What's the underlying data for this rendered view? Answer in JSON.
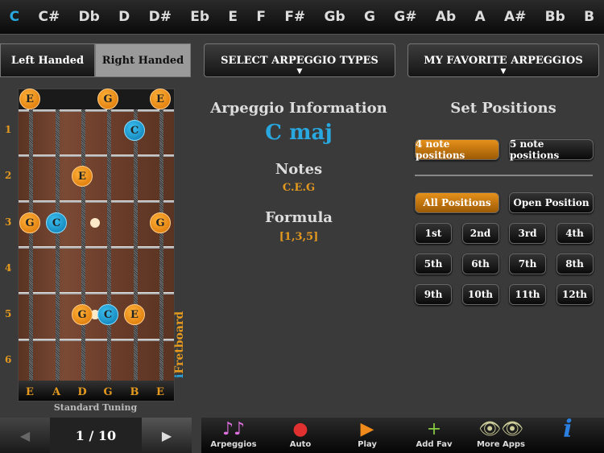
{
  "keys": [
    "C",
    "C#",
    "Db",
    "D",
    "D#",
    "Eb",
    "E",
    "F",
    "F#",
    "Gb",
    "G",
    "G#",
    "Ab",
    "A",
    "A#",
    "Bb",
    "B"
  ],
  "selected_key": "C",
  "hand": {
    "left": "Left Handed",
    "right": "Right Handed",
    "selected": "right"
  },
  "menus": {
    "types": "SELECT ARPEGGIO TYPES",
    "favorites": "MY FAVORITE ARPEGGIOS"
  },
  "info": {
    "title": "Arpeggio Information",
    "name": "C maj",
    "notes_label": "Notes",
    "notes": "C.E.G",
    "formula_label": "Formula",
    "formula": "[1,3,5]"
  },
  "positions": {
    "title": "Set Positions",
    "note_counts": [
      "4 note positions",
      "5 note positions"
    ],
    "selected_count": 0,
    "ranges": [
      "All Positions",
      "Open Position"
    ],
    "selected_range": 0,
    "frets": [
      "1st",
      "2nd",
      "3rd",
      "4th",
      "5th",
      "6th",
      "7th",
      "8th",
      "9th",
      "10th",
      "11th",
      "12th"
    ]
  },
  "fretboard": {
    "fret_numbers": [
      "1",
      "2",
      "3",
      "4",
      "5",
      "6"
    ],
    "strings": [
      "E",
      "A",
      "D",
      "G",
      "B",
      "E"
    ],
    "tuning": "Standard Tuning",
    "brand": "iFretboard",
    "notes": [
      {
        "s": 0,
        "f": 0,
        "n": "E",
        "c": "o"
      },
      {
        "s": 3,
        "f": 0,
        "n": "G",
        "c": "o"
      },
      {
        "s": 5,
        "f": 0,
        "n": "E",
        "c": "o"
      },
      {
        "s": 4,
        "f": 1,
        "n": "C",
        "c": "b"
      },
      {
        "s": 2,
        "f": 2,
        "n": "E",
        "c": "o"
      },
      {
        "s": 0,
        "f": 3,
        "n": "G",
        "c": "o"
      },
      {
        "s": 1,
        "f": 3,
        "n": "C",
        "c": "b"
      },
      {
        "s": 5,
        "f": 3,
        "n": "G",
        "c": "o"
      },
      {
        "s": 2,
        "f": 5,
        "n": "G",
        "c": "o"
      },
      {
        "s": 3,
        "f": 5,
        "n": "C",
        "c": "b"
      },
      {
        "s": 4,
        "f": 5,
        "n": "E",
        "c": "o"
      }
    ]
  },
  "pager": {
    "text": "1 / 10",
    "prev": "◀",
    "next": "▶"
  },
  "toolbar": [
    {
      "label": "Arpeggios",
      "icon": "♪♪"
    },
    {
      "label": "Auto",
      "icon": "●"
    },
    {
      "label": "Play",
      "icon": "▶"
    },
    {
      "label": "Add Fav",
      "icon": "+"
    },
    {
      "label": "More Apps",
      "icon": "👁👁"
    },
    {
      "label": "",
      "icon": "i"
    }
  ]
}
